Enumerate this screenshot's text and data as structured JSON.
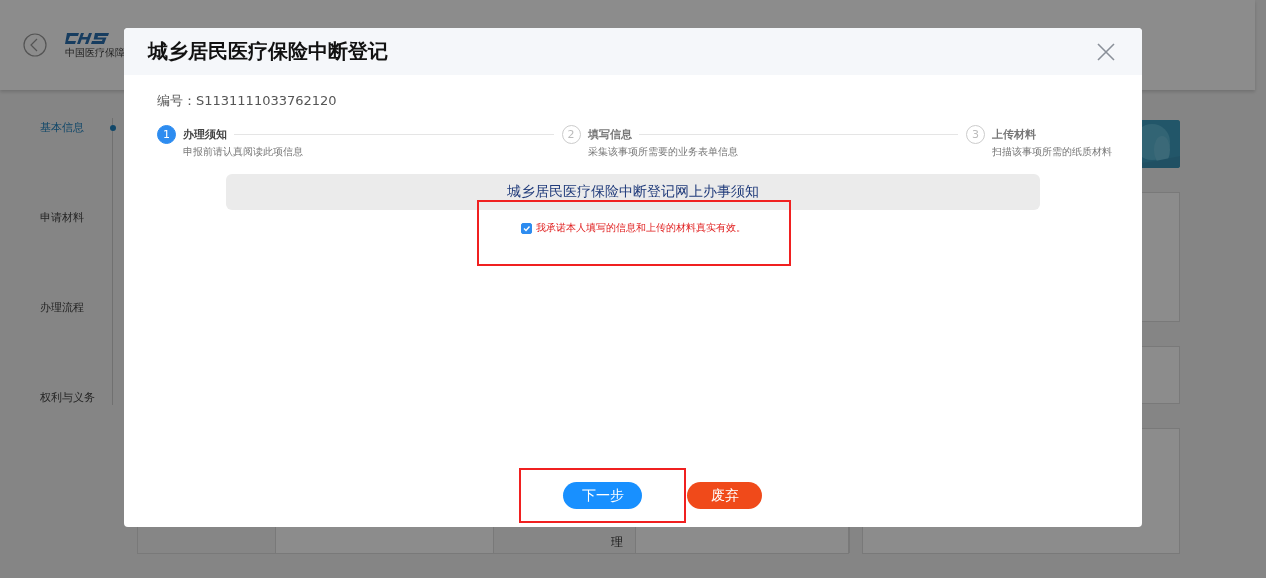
{
  "background": {
    "logo_caption": "中国医疗保障",
    "sidebar": [
      {
        "label": "基本信息",
        "selected": true
      },
      {
        "label": "申请材料",
        "selected": false
      },
      {
        "label": "办理流程",
        "selected": false
      },
      {
        "label": "权利与义务",
        "selected": false
      }
    ],
    "table_fragment": "理"
  },
  "dialog": {
    "title": "城乡居民医疗保险中断登记",
    "number_label": "编号：",
    "number": "S1131111033762120",
    "steps": [
      {
        "index": "1",
        "title": "办理须知",
        "description": "申报前请认真阅读此项信息",
        "selected": true
      },
      {
        "index": "2",
        "title": "填写信息",
        "description": "采集该事项所需要的业务表单信息",
        "selected": false
      },
      {
        "index": "3",
        "title": "上传材料",
        "description": "扫描该事项所需的纸质材料",
        "selected": false
      }
    ],
    "notice_title": "城乡居民医疗保险中断登记网上办事须知",
    "agreement": {
      "label": "我承诺本人填写的信息和上传的材料真实有效。",
      "checked": true,
      "outlined": true
    },
    "buttons": [
      {
        "label": "下一步",
        "kind": "primary",
        "outlined": true
      },
      {
        "label": "废弃",
        "kind": "danger",
        "outlined": false
      }
    ]
  }
}
